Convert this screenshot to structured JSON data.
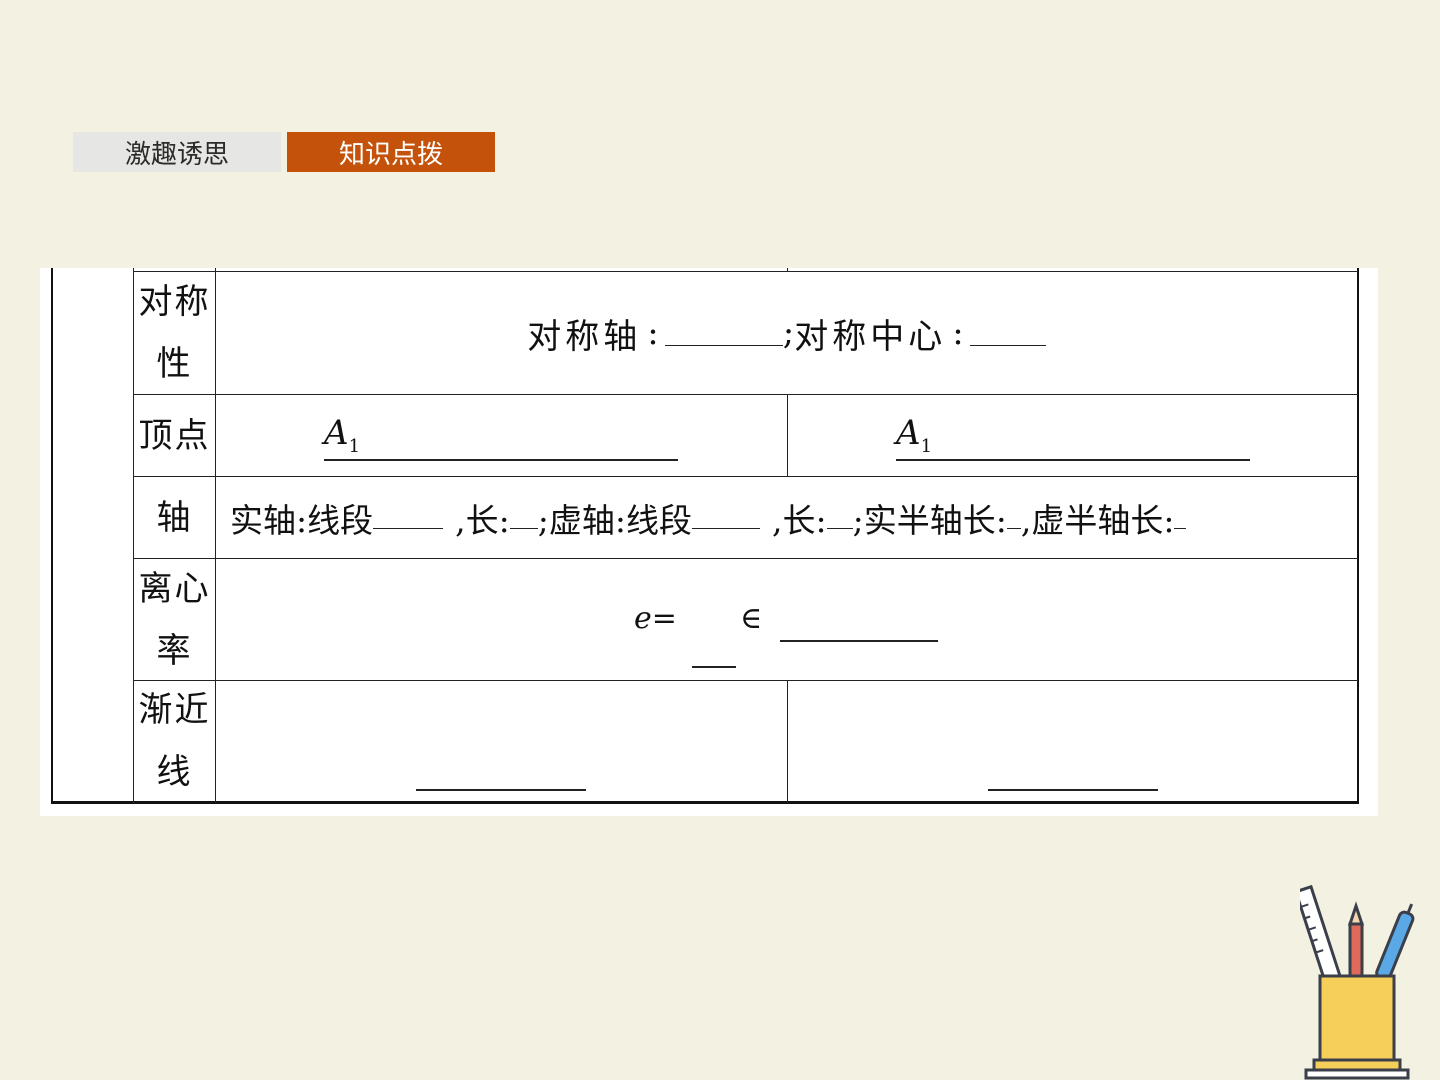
{
  "tabs": [
    {
      "label": "激趣诱思",
      "active": false
    },
    {
      "label": "知识点拨",
      "active": true
    }
  ],
  "table": {
    "symmetry": {
      "label_line1": "对称",
      "label_line2": "性",
      "axis_label": "对称轴",
      "sep": ";",
      "center_label": "对称中心"
    },
    "vertex": {
      "label": "顶点",
      "left_letter": "A",
      "left_sub": "1",
      "right_letter": "A",
      "right_sub": "1"
    },
    "axis": {
      "label": "轴",
      "t1": "实轴:线段",
      "t2": ",长:",
      "t3": ";虚轴:线段",
      "t4": ",长:",
      "t5": ";实半轴长:",
      "t6": ",虚半轴长:"
    },
    "eccentricity": {
      "label_line1": "离心",
      "label_line2": "率",
      "e_text": "e=",
      "in_symbol": "∈"
    },
    "asymptote": {
      "label_line1": "渐近",
      "label_line2": "线"
    }
  },
  "colors": {
    "background": "#f3f1e1",
    "active_tab": "#c4520a",
    "inactive_tab": "#e6e6e4"
  },
  "icons": [
    "pencil-cup-icon"
  ]
}
